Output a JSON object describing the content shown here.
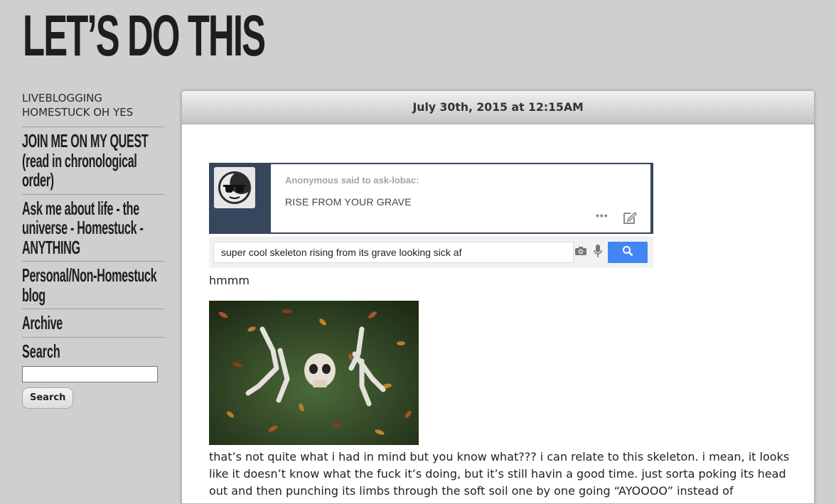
{
  "site": {
    "title": "LET’S DO THIS"
  },
  "sidebar": {
    "tagline": "LIVEBLOGGING HOMESTUCK OH YES",
    "links": [
      {
        "label": "JOIN ME ON MY QUEST (read in chronological order)"
      },
      {
        "label": "Ask me about life - the universe - Homestuck - ANYTHING"
      },
      {
        "label": "Personal/Non-Homestuck blog"
      },
      {
        "label": "Archive"
      }
    ],
    "search": {
      "heading": "Search",
      "input_value": "",
      "button_label": "Search"
    }
  },
  "post": {
    "date": "July 30th, 2015 at 12:15AM",
    "ask": {
      "from": "Anonymous said to ask-lobac:",
      "question": "RISE FROM YOUR GRAVE",
      "more_label": "•••"
    },
    "google_search": {
      "query": "super cool skeleton rising from its grave looking sick af"
    },
    "caption": "hmmm",
    "body": "that’s not quite what i had in mind but you know what??? i can relate to this skeleton. i mean, it looks like it doesn’t know what the fuck it’s doing, but it’s still havin a good time. just sorta poking its head out and then punching its limbs through the soft soil one by one going “AYOOOO” instead of"
  },
  "colors": {
    "page_bg": "#cfcfcf",
    "tumblr_navy": "#36465d",
    "google_blue": "#4285f4"
  },
  "icons": [
    "sunglasses-avatar-icon",
    "more-dots-icon",
    "edit-icon",
    "camera-icon",
    "microphone-icon",
    "search-magnifier-icon"
  ]
}
